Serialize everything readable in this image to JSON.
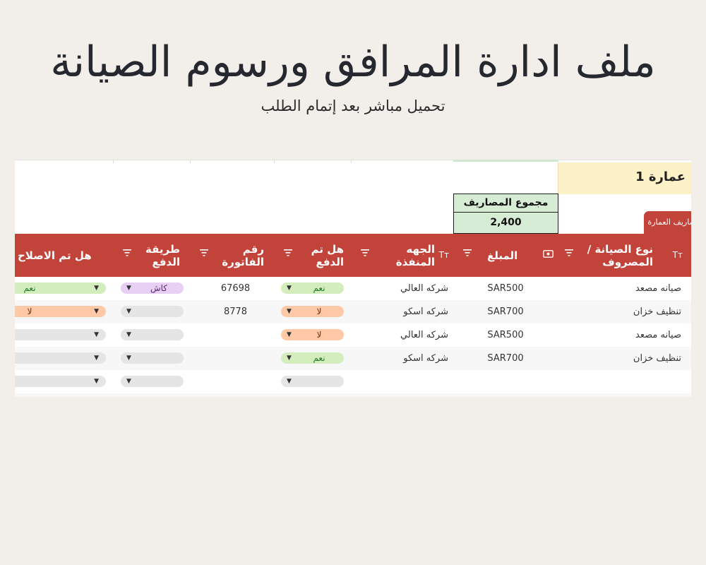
{
  "banner": {
    "title": "ملف ادارة المرافق ورسوم الصيانة",
    "subtitle": "تحميل مباشر بعد إتمام الطلب"
  },
  "sheet": {
    "building_name": "عمارة 1",
    "total_label": "مجموع المصاريف",
    "total_value": "2,400",
    "tab_label": "مصاريف العمارة",
    "colors": {
      "header": "#c2433a",
      "total_fill": "#d6ecd4",
      "building_fill": "#fdf1c7"
    }
  },
  "columns": {
    "type": "نوع الصيانة / المصروف",
    "amount": "المبلغ",
    "vendor": "الجهه المنفذة",
    "paid": "هل تم الدفع",
    "invoice": "رقم الفاتورة",
    "method": "طريقة الدفع",
    "fixed": "هل تم الاصلاح"
  },
  "icons": {
    "text_column": "Tт",
    "currency_column": "banknote-icon",
    "filter": "filter-icon",
    "dropdown": "▼"
  },
  "rows": [
    {
      "type": "صيانه مصعد",
      "amount": "SAR500",
      "vendor": "شركه العالي",
      "paid": "نعم",
      "invoice": "67698",
      "method": "كاش",
      "fixed": "نعم"
    },
    {
      "type": "تنظيف خزان",
      "amount": "SAR700",
      "vendor": "شركه اسكو",
      "paid": "لا",
      "invoice": "8778",
      "method": "",
      "fixed": "لا"
    },
    {
      "type": "صيانه مصعد",
      "amount": "SAR500",
      "vendor": "شركه العالي",
      "paid": "لا",
      "invoice": "",
      "method": "",
      "fixed": ""
    },
    {
      "type": "تنظيف خزان",
      "amount": "SAR700",
      "vendor": "شركه اسكو",
      "paid": "نعم",
      "invoice": "",
      "method": "",
      "fixed": ""
    },
    {
      "type": "",
      "amount": "",
      "vendor": "",
      "paid": "",
      "invoice": "",
      "method": "",
      "fixed": ""
    }
  ]
}
